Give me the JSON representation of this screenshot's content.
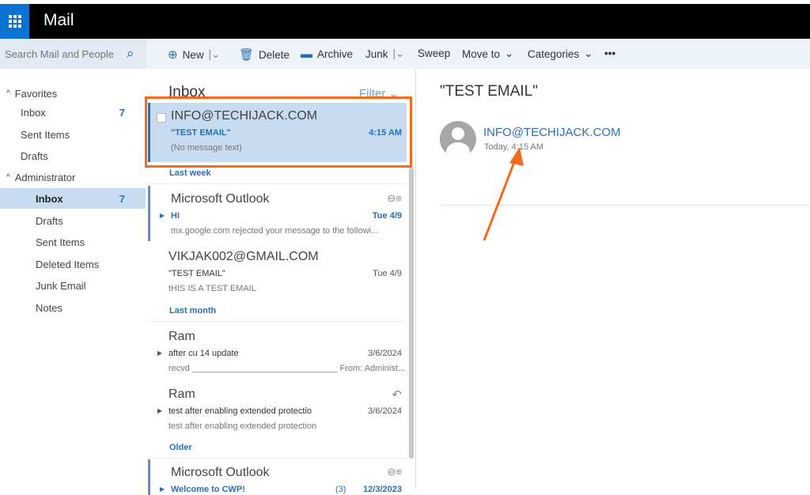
{
  "app": {
    "title": "Mail"
  },
  "search": {
    "placeholder": "Search Mail and People"
  },
  "toolbar": {
    "new": "New",
    "delete": "Delete",
    "archive": "Archive",
    "junk": "Junk",
    "sweep": "Sweep",
    "move_to": "Move to",
    "categories": "Categories",
    "more": "•••"
  },
  "sidebar": {
    "favorites": "Favorites",
    "fav_items": [
      {
        "label": "Inbox",
        "count": "7"
      },
      {
        "label": "Sent Items"
      },
      {
        "label": "Drafts"
      }
    ],
    "account": "Administrator",
    "items": [
      {
        "label": "Inbox",
        "count": "7"
      },
      {
        "label": "Drafts"
      },
      {
        "label": "Sent Items"
      },
      {
        "label": "Deleted Items"
      },
      {
        "label": "Junk Email"
      },
      {
        "label": "Notes"
      }
    ]
  },
  "list": {
    "title": "Inbox",
    "filter": "Filter",
    "groups": [
      "Last week",
      "Last month",
      "Older"
    ],
    "messages": [
      {
        "from": "INFO@TECHIJACK.COM",
        "subject": "\"TEST EMAIL\"",
        "date": "4:15 AM",
        "preview": "(No message text)"
      },
      {
        "from": "Microsoft Outlook",
        "subject": "HI",
        "date": "Tue 4/9",
        "preview": "mx.google.com rejected your message to the followi..."
      },
      {
        "from": "VIKJAK002@GMAIL.COM",
        "subject": "\"TEST EMAIL\"",
        "date": "Tue 4/9",
        "preview": "tHIS IS A TEST EMAIL"
      },
      {
        "from": "Ram",
        "subject": "after cu 14 update",
        "date": "3/6/2024",
        "preview": "recvd ______________________________ From: Administ..."
      },
      {
        "from": "Ram",
        "subject": "test after enabling extended protectio",
        "date": "3/6/2024",
        "preview": "test after enabling extended protection"
      },
      {
        "from": "Microsoft Outlook",
        "subject": "Welcome to CWP!",
        "count": "(3)",
        "date": "12/3/2023"
      }
    ]
  },
  "reading": {
    "subject": "\"TEST EMAIL\"",
    "sender": "INFO@TECHIJACK.COM",
    "time": "Today, 4:15 AM"
  },
  "colors": {
    "accent": "#2a6fb5",
    "highlight": "#f26b1d",
    "selected": "#c7dcf0"
  }
}
